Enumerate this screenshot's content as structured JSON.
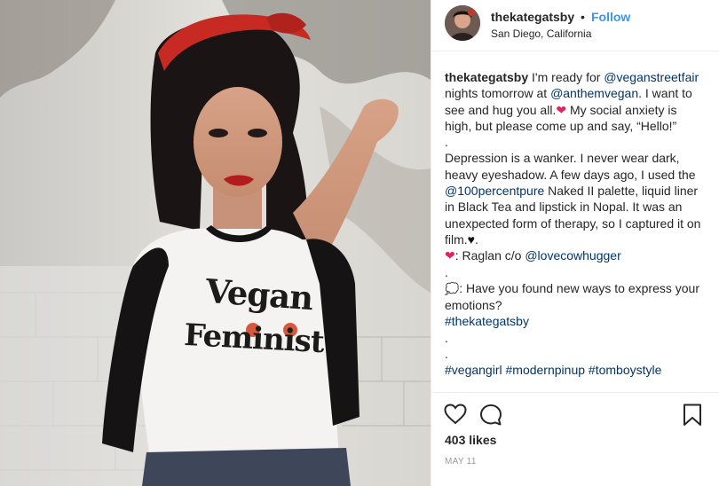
{
  "post": {
    "username": "thekategatsby",
    "separator": "•",
    "follow_label": "Follow",
    "location": "San Diego, California",
    "likes": "403 likes",
    "date": "MAY 11",
    "shirt_line1": "Vegan",
    "shirt_line2": "Feminist"
  },
  "caption": {
    "author": "thekategatsby",
    "p1_a": " I'm ready for ",
    "link_streetfair": "@veganstreetfair",
    "p1_b": " nights tomorrow at ",
    "link_anthem": "@anthemvegan",
    "p1_c": ". I want to see and hug you all.",
    "heart": "❤",
    "p1_d": " My social anxiety is high, but please come up and say, “Hello!”",
    "dot1": ".",
    "p2_a": "Depression is a wanker. I never wear dark, heavy eyeshadow. A few days ago, I used the ",
    "link_100": "@100percentpure",
    "p2_b": " Naked II palette, liquid liner in Black Tea and lipstick in Nopal. It was an unexpected form of therapy, so I captured it on film.",
    "black_heart": "♥",
    "p2_c": ".",
    "heart2": "❤",
    "p3_a": ": Raglan c/o ",
    "link_cowhugger": "@lovecowhugger",
    "dot2": ".",
    "bubble": "💭",
    "p4_a": ": Have you found new ways to express your emotions?",
    "tag_kate": "#thekategatsby",
    "dot3": ".",
    "dot4": ".",
    "tag_vegangirl": "#vegangirl",
    "tag_pinup": "#modernpinup",
    "tag_tomboy": "#tomboystyle"
  },
  "icons": {
    "like": "heart-outline-icon",
    "comment": "comment-icon",
    "save": "bookmark-icon"
  },
  "colors": {
    "link": "#003569",
    "follow": "#3897f0",
    "heart": "#e0245e"
  }
}
